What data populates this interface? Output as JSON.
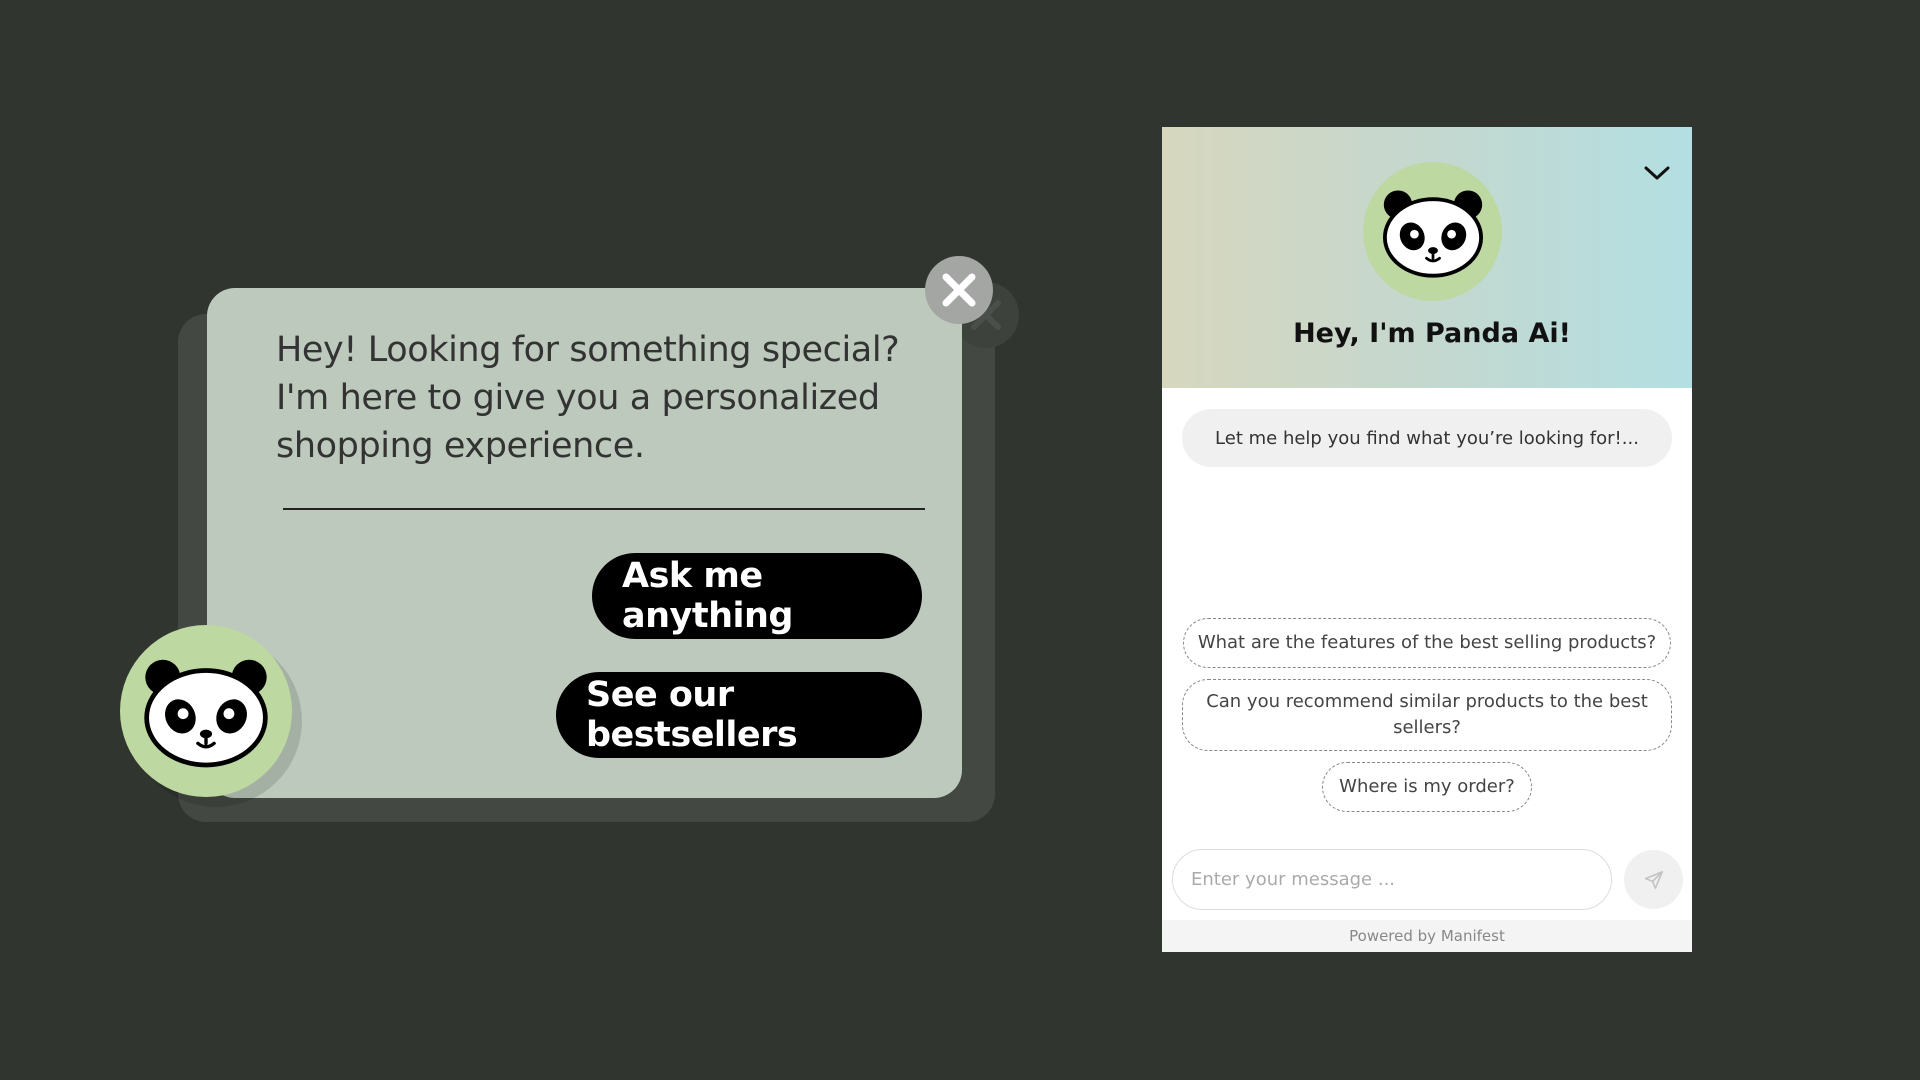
{
  "colors": {
    "page_background": "#303530",
    "popup_background": "#bcc9bc",
    "avatar_green": "#bdd8a1",
    "button_black": "#000000",
    "header_gradient_left": "#d7d7be",
    "header_gradient_right": "#b3dfe2"
  },
  "popup": {
    "message": "Hey! Looking for something special? I'm here to give you a personalized shopping experience.",
    "ask_button": "Ask me anything",
    "bestsellers_button": "See our bestsellers",
    "close_icon": "close-icon",
    "avatar_icon": "panda-icon"
  },
  "widget": {
    "title": "Hey, I'm Panda Ai!",
    "avatar_icon": "panda-icon",
    "collapse_icon": "chevron-down-icon",
    "welcome_message": "Let me help you find what you’re looking for!...",
    "suggestions": [
      "What are the features of the best selling products?",
      "Can you recommend similar products to the best sellers?",
      "Where is my order?"
    ],
    "input_placeholder": "Enter your message ...",
    "send_icon": "send-icon",
    "footer": "Powered by Manifest"
  }
}
